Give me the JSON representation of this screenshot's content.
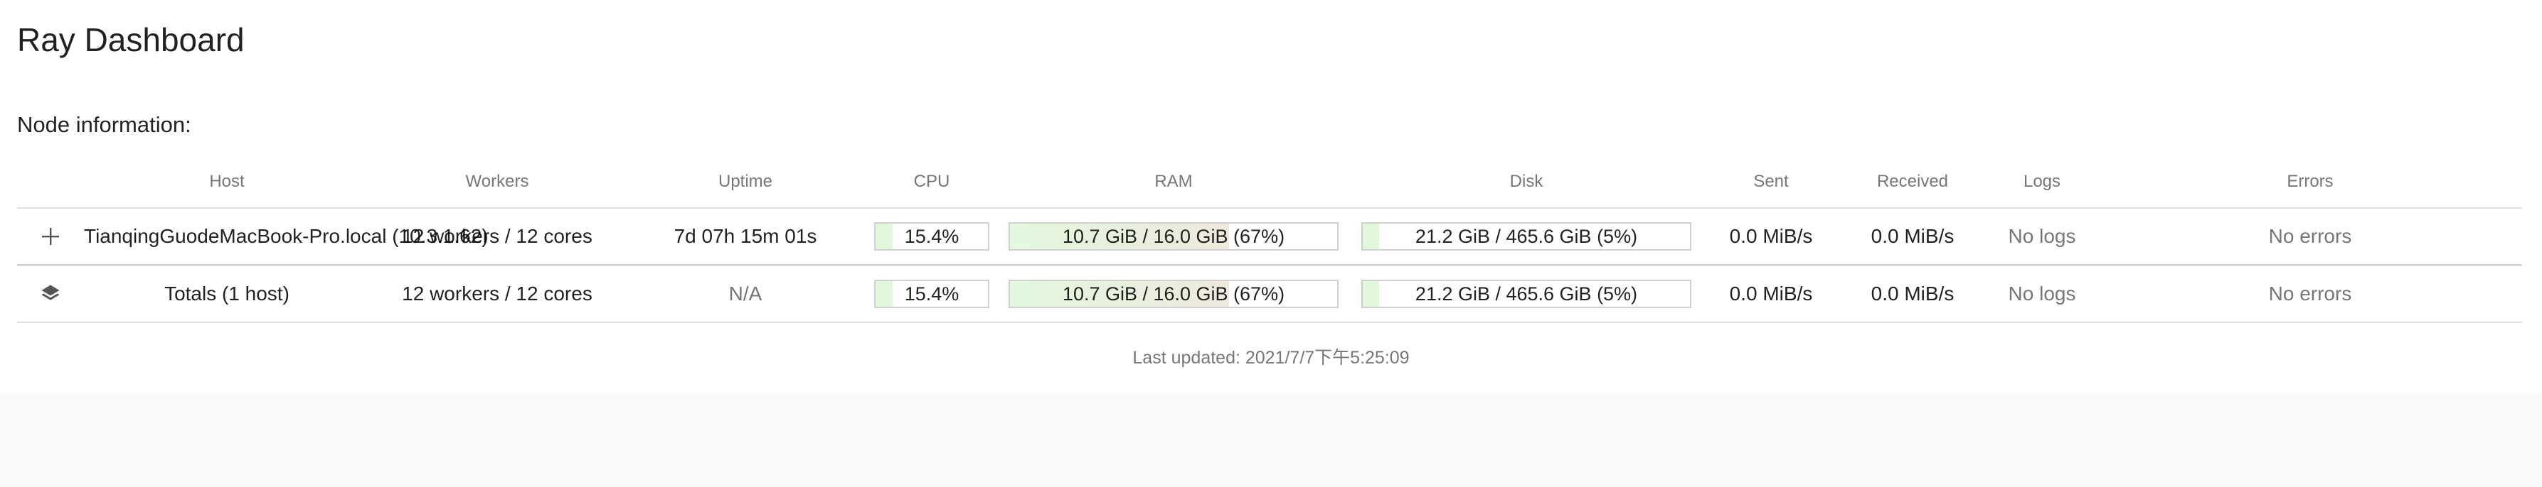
{
  "app": {
    "title": "Ray Dashboard"
  },
  "section": {
    "title": "Node information:"
  },
  "table": {
    "columns": [
      "",
      "Host",
      "Workers",
      "Uptime",
      "CPU",
      "RAM",
      "Disk",
      "Sent",
      "Received",
      "Logs",
      "Errors"
    ],
    "rows": [
      {
        "icon": "plus-icon",
        "host": "TianqingGuodeMacBook-Pro.local (10.3.1.62)",
        "workers": "12 workers / 12 cores",
        "uptime": "7d 07h 15m 01s",
        "cpu_label": "15.4%",
        "cpu_fraction": 0.154,
        "ram_label": "10.7 GiB / 16.0 GiB (67%)",
        "ram_fraction": 0.67,
        "disk_label": "21.2 GiB / 465.6 GiB (5%)",
        "disk_fraction": 0.05,
        "sent": "0.0 MiB/s",
        "received": "0.0 MiB/s",
        "logs": "No logs",
        "errors": "No errors"
      },
      {
        "icon": "layers-icon",
        "host": "Totals (1 host)",
        "workers": "12 workers / 12 cores",
        "uptime": "N/A",
        "cpu_label": "15.4%",
        "cpu_fraction": 0.154,
        "ram_label": "10.7 GiB / 16.0 GiB (67%)",
        "ram_fraction": 0.67,
        "disk_label": "21.2 GiB / 465.6 GiB (5%)",
        "disk_fraction": 0.05,
        "sent": "0.0 MiB/s",
        "received": "0.0 MiB/s",
        "logs": "No logs",
        "errors": "No errors"
      }
    ]
  },
  "footer": {
    "last_updated": "Last updated: 2021/7/7下午5:25:09"
  },
  "colors": {
    "background": "#fafafa",
    "panel": "#ffffff",
    "bar_fill": "#e1f7dc",
    "bar_fill_warm": "#eee9dd",
    "divider": "#e0e0e0"
  }
}
